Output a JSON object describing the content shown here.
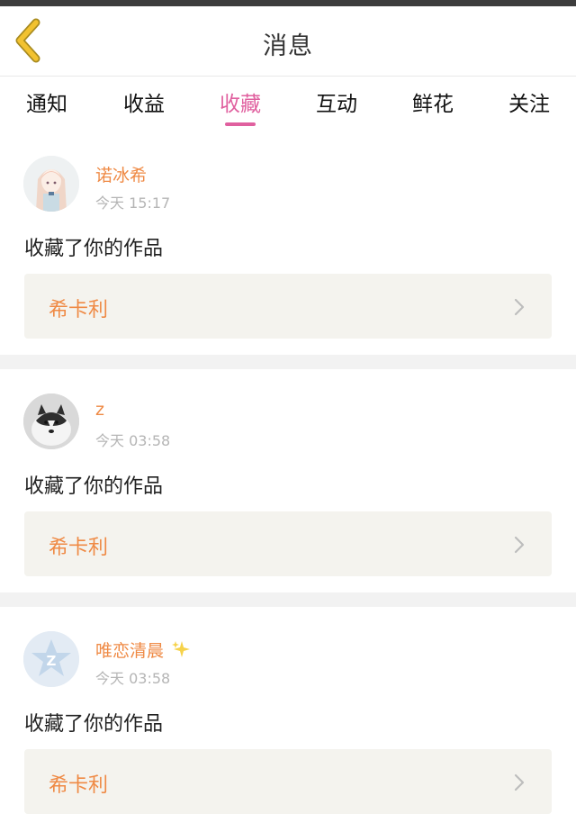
{
  "header": {
    "title": "消息",
    "back_icon": "chevron-left-icon",
    "back_color": "#f2c230"
  },
  "tabs": [
    {
      "label": "通知",
      "active": false
    },
    {
      "label": "收益",
      "active": false
    },
    {
      "label": "收藏",
      "active": true
    },
    {
      "label": "互动",
      "active": false
    },
    {
      "label": "鲜花",
      "active": false
    },
    {
      "label": "关注",
      "active": false
    }
  ],
  "accent_color": "#e0609f",
  "name_color": "#ef8a45",
  "messages": [
    {
      "username": "诺冰希",
      "time": "今天 15:17",
      "action": "收藏了你的作品",
      "work_title": "希卡利",
      "avatar": "anime-girl-avatar"
    },
    {
      "username": "z",
      "time": "今天 03:58",
      "action": "收藏了你的作品",
      "work_title": "希卡利",
      "avatar": "husky-dog-avatar"
    },
    {
      "username": "唯恋清晨",
      "time": "今天 03:58",
      "action": "收藏了你的作品",
      "work_title": "希卡利",
      "avatar": "default-star-avatar",
      "badge_icon": "sparkle-icon"
    }
  ]
}
